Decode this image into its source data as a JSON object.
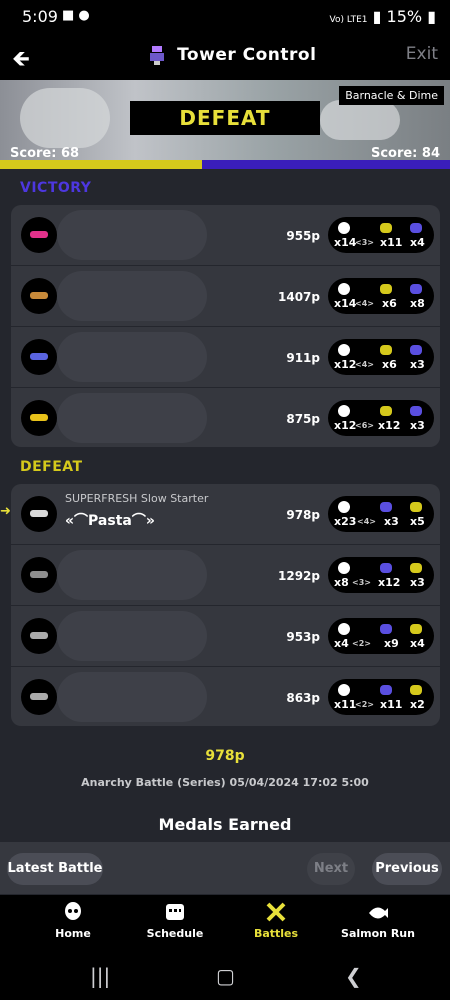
{
  "status": {
    "time": "5:09",
    "battery": "15%",
    "network": "Vo) LTE1"
  },
  "header": {
    "title": "Tower Control",
    "exit_label": "Exit"
  },
  "banner": {
    "stage": "Barnacle & Dime",
    "result": "DEFEAT",
    "score_left": "Score: 68",
    "score_right": "Score: 84"
  },
  "teams": {
    "victory": {
      "label": "VICTORY",
      "players": [
        {
          "points": "955p",
          "kills": "x14",
          "assists": "<3>",
          "specials": "x11",
          "special_uses": "x4"
        },
        {
          "points": "1407p",
          "kills": "x14",
          "assists": "<4>",
          "specials": "x6",
          "special_uses": "x8"
        },
        {
          "points": "911p",
          "kills": "x12",
          "assists": "<4>",
          "specials": "x6",
          "special_uses": "x3"
        },
        {
          "points": "875p",
          "kills": "x12",
          "assists": "<6>",
          "specials": "x12",
          "special_uses": "x3"
        }
      ]
    },
    "defeat": {
      "label": "DEFEAT",
      "players": [
        {
          "title": "SUPERFRESH Slow Starter",
          "nickname": "«⌒Pasta⌒»",
          "points": "978p",
          "kills": "x23",
          "assists": "<4>",
          "specials": "x3",
          "special_uses": "x5"
        },
        {
          "points": "1292p",
          "kills": "x8",
          "assists": "<3>",
          "specials": "x12",
          "special_uses": "x3"
        },
        {
          "points": "953p",
          "kills": "x4",
          "assists": "<2>",
          "specials": "x9",
          "special_uses": "x4"
        },
        {
          "points": "863p",
          "kills": "x11",
          "assists": "<2>",
          "specials": "x11",
          "special_uses": "x2"
        }
      ]
    }
  },
  "summary": {
    "self_points": "978p",
    "meta": "Anarchy Battle (Series) 05/04/2024 17:02 5:00",
    "medals_heading": "Medals Earned"
  },
  "buttons": {
    "latest": "Latest Battle",
    "next": "Next",
    "previous": "Previous"
  },
  "nav": {
    "home": "Home",
    "schedule": "Schedule",
    "battles": "Battles",
    "salmon": "Salmon Run"
  },
  "colors": {
    "victory": "#3a1eba",
    "defeat": "#d5c91c",
    "accent": "#e8e03a"
  }
}
